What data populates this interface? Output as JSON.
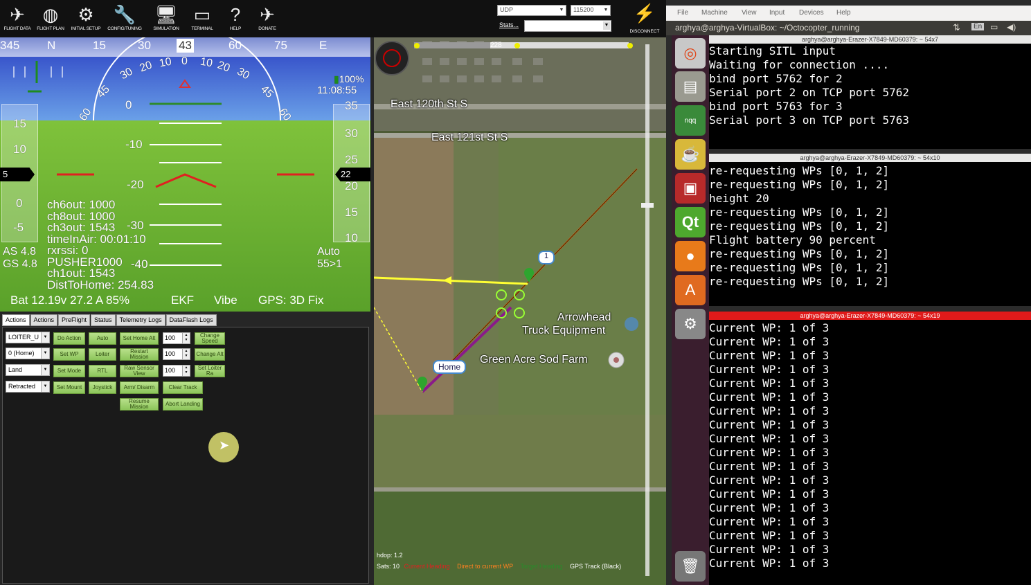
{
  "toolbar": {
    "buttons": [
      "FLIGHT DATA",
      "FLIGHT PLAN",
      "INITIAL SETUP",
      "CONFIG/TUNING",
      "SIMULATION",
      "TERMINAL",
      "HELP",
      "DONATE"
    ],
    "connection_type": "UDP",
    "baud": "115200",
    "stats_label": "Stats...",
    "disconnect_label": "DISCONNECT"
  },
  "hud": {
    "compass": [
      "345",
      "N",
      "15",
      "30",
      "43",
      "60",
      "75",
      "E"
    ],
    "signal": "100%",
    "time": "11:08:55",
    "pitch_labels": [
      "0",
      "-10",
      "-20",
      "-30",
      "-40"
    ],
    "roll_labels": [
      "60",
      "45",
      "30",
      "20",
      "10",
      "0",
      "10",
      "20",
      "30",
      "45",
      "60"
    ],
    "speed_ticks": [
      "15",
      "10",
      "5",
      "0",
      "-5"
    ],
    "alt_ticks": [
      "35",
      "30",
      "25",
      "22",
      "20",
      "15",
      "10"
    ],
    "params": [
      "ch6out: 1000",
      "ch8out: 1000",
      "ch3out: 1543",
      "timeInAir: 00:01:10",
      "rxrssi: 0",
      "PUSHER1000",
      "ch1out: 1543",
      "DistToHome: 254.83"
    ],
    "as": "AS 4.8",
    "gs": "GS 4.8",
    "mode": "Auto",
    "wp": "55>1",
    "battery": "Bat 12.19v 27.2 A 85%",
    "ekf": "EKF",
    "vibe": "Vibe",
    "gps": "GPS: 3D Fix"
  },
  "actions": {
    "tabs": [
      "Actions",
      "Actions",
      "PreFlight",
      "Status",
      "Telemetry Logs",
      "DataFlash Logs"
    ],
    "combos": [
      "LOITER_U",
      "0 (Home)",
      "Land",
      "Retracted"
    ],
    "numbers": [
      "100",
      "100",
      "100"
    ],
    "buttons": {
      "do_action": "Do Action",
      "auto": "Auto",
      "set_home_alt": "Set Home Alt",
      "change_speed": "Change Speed",
      "set_wp": "Set WP",
      "loiter": "Loiter",
      "restart_mission": "Restart Mission",
      "change_alt": "Change Alt",
      "set_mode": "Set Mode",
      "rtl": "RTL",
      "raw_sensor_view": "Raw Sensor View",
      "set_loiter_rad": "Set Loiter Ra",
      "set_mount": "Set Mount",
      "joystick": "Joystick",
      "arm_disarm": "Arm/ Disarm",
      "clear_track": "Clear Track",
      "resume_mission": "Resume Mission",
      "abort_landing": "Abort Landing"
    }
  },
  "map": {
    "labels": [
      "East 120th St S",
      "East 121st St S",
      "Arrowhead",
      "Truck Equipment",
      "Green Acre Sod Farm",
      "Home",
      "1",
      "228"
    ],
    "hdop": "hdop: 1.2",
    "sats": "Sats: 10",
    "legend": [
      "Current Heading",
      "Direct to current WP",
      "Target Heading",
      "GPS Track (Black)"
    ]
  },
  "vbox": {
    "menu": [
      "File",
      "Machine",
      "View",
      "Input",
      "Devices",
      "Help"
    ],
    "title": "arghya@arghya-VirtualBox: ~/Octocopter_running",
    "lang": "En"
  },
  "terminals": [
    {
      "title": "arghya@arghya-Erazer-X7849-MD60379: ~ 54x7",
      "lines": [
        "Starting SITL input",
        "Waiting for connection ....",
        "bind port 5762 for 2",
        "Serial port 2 on TCP port 5762",
        "bind port 5763 for 3",
        "Serial port 3 on TCP port 5763"
      ]
    },
    {
      "title": "arghya@arghya-Erazer-X7849-MD60379: ~ 54x10",
      "lines": [
        "re-requesting WPs [0, 1, 2]",
        "re-requesting WPs [0, 1, 2]",
        "height 20",
        "re-requesting WPs [0, 1, 2]",
        "re-requesting WPs [0, 1, 2]",
        "Flight battery 90 percent",
        "re-requesting WPs [0, 1, 2]",
        "re-requesting WPs [0, 1, 2]",
        "re-requesting WPs [0, 1, 2]"
      ]
    },
    {
      "title": "arghya@arghya-Erazer-X7849-MD60379: ~ 54x19",
      "lines": [
        "Current WP: 1 of 3",
        "Current WP: 1 of 3",
        "Current WP: 1 of 3",
        "Current WP: 1 of 3",
        "Current WP: 1 of 3",
        "Current WP: 1 of 3",
        "Current WP: 1 of 3",
        "Current WP: 1 of 3",
        "Current WP: 1 of 3",
        "Current WP: 1 of 3",
        "Current WP: 1 of 3",
        "Current WP: 1 of 3",
        "Current WP: 1 of 3",
        "Current WP: 1 of 3",
        "Current WP: 1 of 3",
        "Current WP: 1 of 3",
        "Current WP: 1 of 3",
        "Current WP: 1 of 3"
      ]
    }
  ]
}
